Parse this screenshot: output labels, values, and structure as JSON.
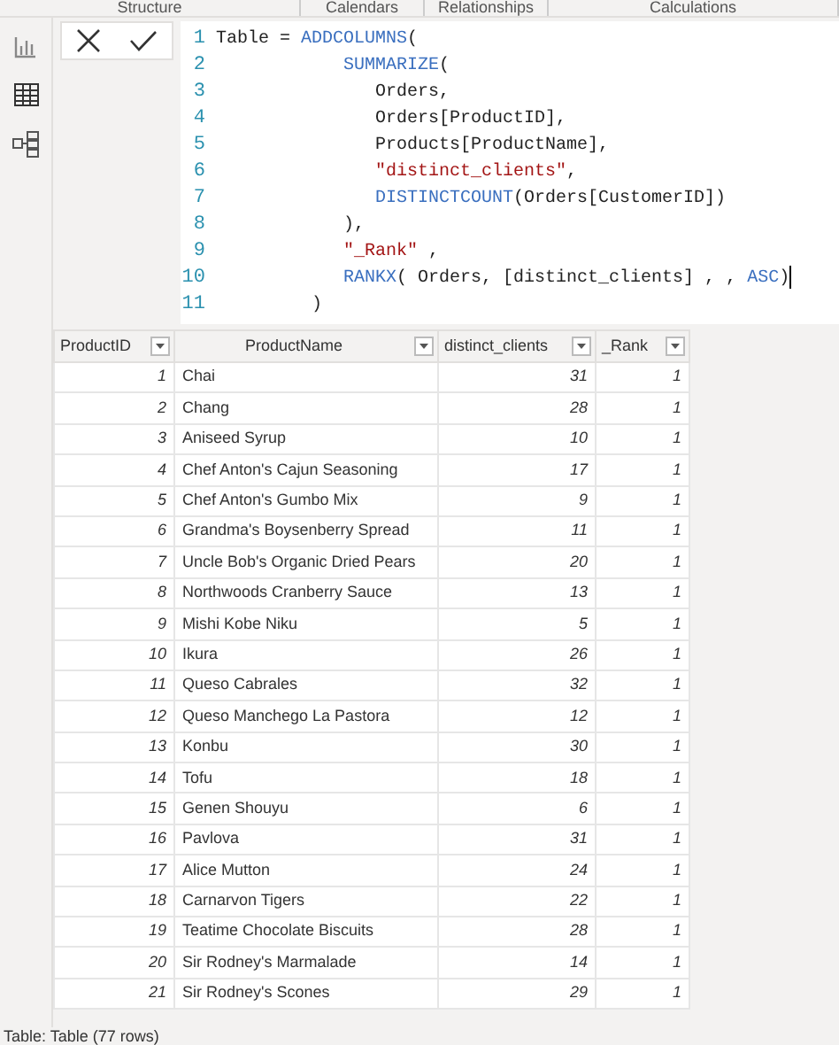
{
  "ribbon_groups": [
    "Structure",
    "Calendars",
    "Relationships",
    "Calculations"
  ],
  "formula": {
    "lines": [
      [
        {
          "kind": "plain",
          "text": "Table = "
        },
        {
          "kind": "function",
          "text": "ADDCOLUMNS"
        },
        {
          "kind": "plain",
          "text": "("
        }
      ],
      [
        {
          "kind": "function",
          "text": "SUMMARIZE"
        },
        {
          "kind": "plain",
          "text": "("
        }
      ],
      [
        {
          "kind": "plain",
          "text": "Orders,"
        }
      ],
      [
        {
          "kind": "plain",
          "text": "Orders[ProductID],"
        }
      ],
      [
        {
          "kind": "plain",
          "text": "Products[ProductName],"
        }
      ],
      [
        {
          "kind": "string",
          "text": "\"distinct_clients\""
        },
        {
          "kind": "plain",
          "text": ","
        }
      ],
      [
        {
          "kind": "function",
          "text": "DISTINCTCOUNT"
        },
        {
          "kind": "plain",
          "text": "(Orders[CustomerID])"
        }
      ],
      [
        {
          "kind": "plain",
          "text": "),"
        }
      ],
      [
        {
          "kind": "string",
          "text": "\"_Rank\""
        },
        {
          "kind": "plain",
          "text": " ,"
        }
      ],
      [
        {
          "kind": "function",
          "text": "RANKX"
        },
        {
          "kind": "plain",
          "text": "( Orders, [distinct_clients] , , "
        },
        {
          "kind": "function",
          "text": "ASC"
        },
        {
          "kind": "plain",
          "text": ")"
        }
      ],
      [
        {
          "kind": "plain",
          "text": ")"
        }
      ]
    ],
    "line_numbers": [
      "1",
      "2",
      "3",
      "4",
      "5",
      "6",
      "7",
      "8",
      "9",
      "10",
      "11"
    ]
  },
  "table": {
    "columns": [
      "ProductID",
      "ProductName",
      "distinct_clients",
      "_Rank"
    ],
    "rows": [
      [
        "1",
        "Chai",
        "31",
        "1"
      ],
      [
        "2",
        "Chang",
        "28",
        "1"
      ],
      [
        "3",
        "Aniseed Syrup",
        "10",
        "1"
      ],
      [
        "4",
        "Chef Anton's Cajun Seasoning",
        "17",
        "1"
      ],
      [
        "5",
        "Chef Anton's Gumbo Mix",
        "9",
        "1"
      ],
      [
        "6",
        "Grandma's Boysenberry Spread",
        "11",
        "1"
      ],
      [
        "7",
        "Uncle Bob's Organic Dried Pears",
        "20",
        "1"
      ],
      [
        "8",
        "Northwoods Cranberry Sauce",
        "13",
        "1"
      ],
      [
        "9",
        "Mishi Kobe Niku",
        "5",
        "1"
      ],
      [
        "10",
        "Ikura",
        "26",
        "1"
      ],
      [
        "11",
        "Queso Cabrales",
        "32",
        "1"
      ],
      [
        "12",
        "Queso Manchego La Pastora",
        "12",
        "1"
      ],
      [
        "13",
        "Konbu",
        "30",
        "1"
      ],
      [
        "14",
        "Tofu",
        "18",
        "1"
      ],
      [
        "15",
        "Genen Shouyu",
        "6",
        "1"
      ],
      [
        "16",
        "Pavlova",
        "31",
        "1"
      ],
      [
        "17",
        "Alice Mutton",
        "24",
        "1"
      ],
      [
        "18",
        "Carnarvon Tigers",
        "22",
        "1"
      ],
      [
        "19",
        "Teatime Chocolate Biscuits",
        "28",
        "1"
      ],
      [
        "20",
        "Sir Rodney's Marmalade",
        "14",
        "1"
      ],
      [
        "21",
        "Sir Rodney's Scones",
        "29",
        "1"
      ]
    ]
  },
  "status_bar": "Table: Table (77 rows)"
}
